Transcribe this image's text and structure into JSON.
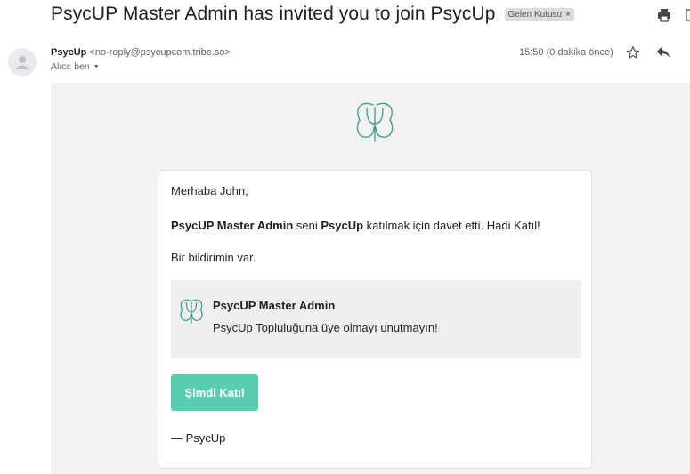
{
  "subject": "PsycUP Master Admin has invited you to join PsycUp",
  "label_chip": {
    "text": "Gelen Kutusu",
    "close": "×"
  },
  "sender": {
    "name": "PsycUp",
    "email": "<no-reply@psycupcom.tribe.so>"
  },
  "recipient": {
    "text": "Alıcı: ben"
  },
  "timestamp": "15:50 (0 dakika önce)",
  "body": {
    "greeting": "Merhaba John,",
    "invite": {
      "inviter": "PsycUP Master Admin",
      "middle": " seni ",
      "community": "PsycUp",
      "end": " katılmak için davet etti. Hadi Katıl!"
    },
    "notification_line": "Bir bildirimin var.",
    "notification": {
      "title": "PsycUP Master Admin",
      "message": "PsycUp Topluluğuna üye olmayı unutmayın!"
    },
    "cta_label": "Şimdi Katıl",
    "signoff": "— PsycUp"
  },
  "colors": {
    "accent": "#58cdb0",
    "logo_stroke": "#3a9a8a",
    "email_background": "#f2f2f2"
  },
  "icons": [
    "print-icon",
    "new-window-icon",
    "avatar-person-icon",
    "star-icon",
    "reply-icon",
    "psycup-logo-icon"
  ]
}
